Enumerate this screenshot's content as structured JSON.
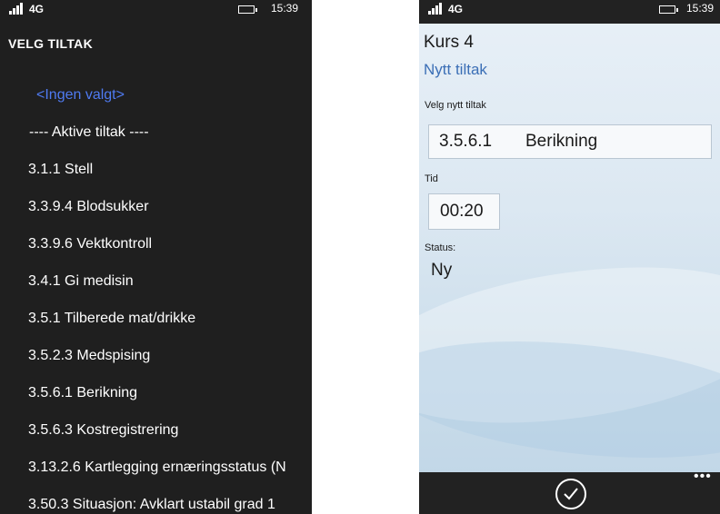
{
  "left_screen": {
    "status_bar": {
      "network": "4G",
      "time": "15:39"
    },
    "title": "VELG TILTAK",
    "options": [
      {
        "label": "<Ingen valgt>",
        "selected": true
      },
      {
        "label": "---- Aktive tiltak ----",
        "header": true
      },
      {
        "label": "3.1.1 Stell"
      },
      {
        "label": "3.3.9.4 Blodsukker"
      },
      {
        "label": "3.3.9.6 Vektkontroll"
      },
      {
        "label": "3.4.1 Gi medisin"
      },
      {
        "label": "3.5.1 Tilberede mat/drikke"
      },
      {
        "label": "3.5.2.3 Medspising"
      },
      {
        "label": "3.5.6.1 Berikning"
      },
      {
        "label": "3.5.6.3 Kostregistrering"
      },
      {
        "label": "3.13.2.6 Kartlegging ernæringsstatus (N"
      },
      {
        "label": "3.50.3 Situasjon: Avklart ustabil grad 1"
      }
    ]
  },
  "right_screen": {
    "status_bar": {
      "network": "4G",
      "time": "15:39"
    },
    "course_title": "Kurs 4",
    "subtitle": "Nytt tiltak",
    "measure_label": "Velg nytt tiltak",
    "measure_code": "3.5.6.1",
    "measure_name": "Berikning",
    "time_label": "Tid",
    "time_value": "00:20",
    "status_label": "Status:",
    "status_value": "Ny",
    "appbar": {
      "confirm_icon": "checkmark-circle-icon",
      "more_icon": "more-dots-icon"
    }
  },
  "colors": {
    "left_background": "#1f1f1f",
    "selected_option": "#4f7bf2",
    "subtitle_accent": "#3b6fb6",
    "appbar_background": "#222222"
  }
}
